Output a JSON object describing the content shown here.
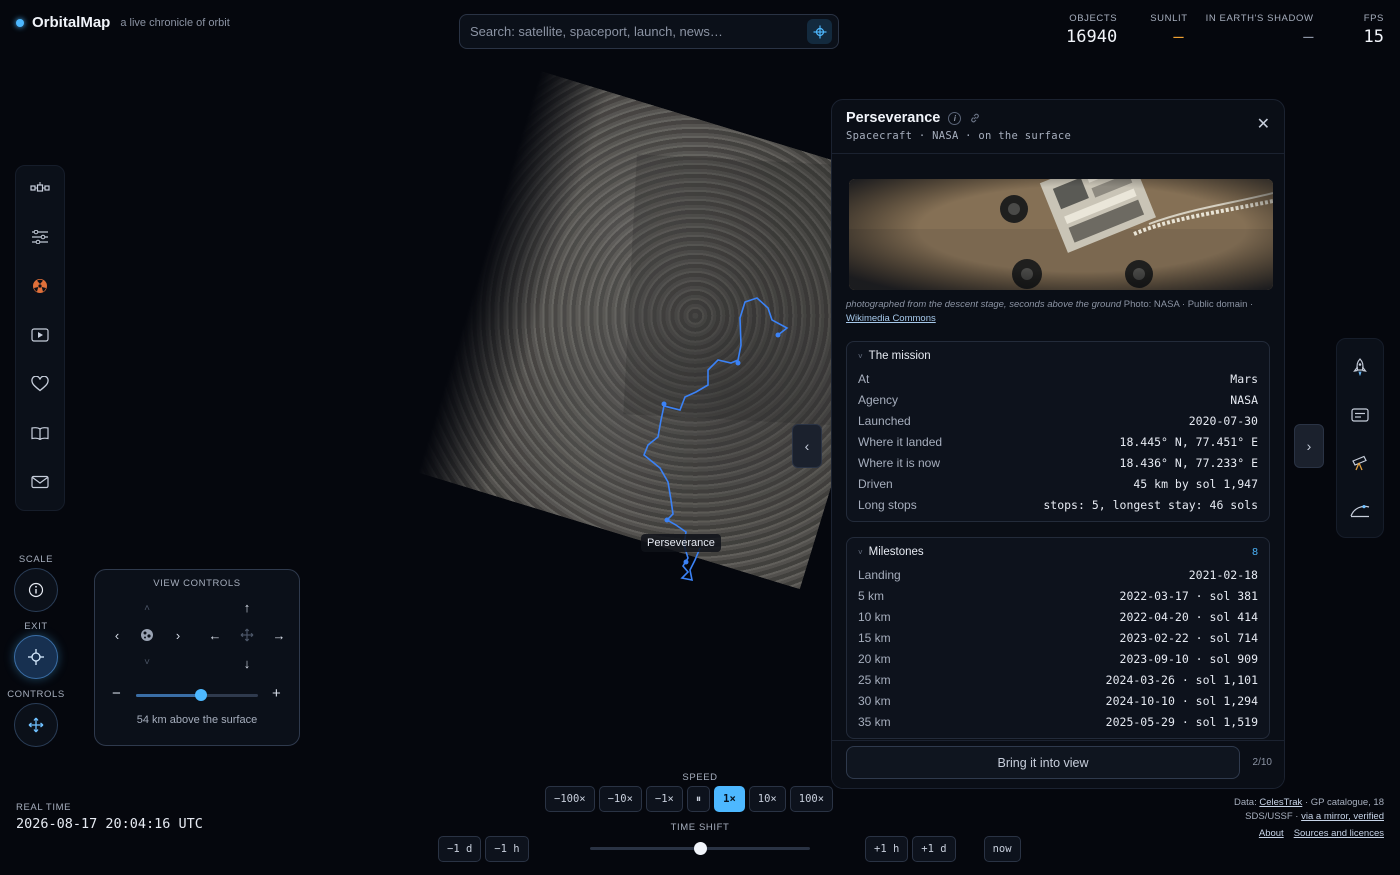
{
  "brand": {
    "name": "OrbitalMap",
    "tagline": "a live chronicle of orbit"
  },
  "search": {
    "placeholder": "Search: satellite, spaceport, launch, news…",
    "icon": "crosshair-icon"
  },
  "stats": [
    {
      "label": "OBJECTS",
      "value": "16940"
    },
    {
      "label": "SUNLIT",
      "value": "–"
    },
    {
      "label": "IN EARTH'S SHADOW",
      "value": "–"
    },
    {
      "label": "FPS",
      "value": "15"
    }
  ],
  "left_rail": [
    "satellite-icon",
    "sliders-icon",
    "radiation-icon",
    "play-icon",
    "heart-icon",
    "book-icon",
    "mail-icon"
  ],
  "side_controls": {
    "scale_label": "SCALE",
    "exit_label": "EXIT",
    "controls_label": "CONTROLS"
  },
  "view_controls": {
    "title": "VIEW CONTROLS",
    "altitude_text": "54 km above the surface",
    "zoom_level": 0.53
  },
  "map": {
    "label": "Perseverance"
  },
  "panel": {
    "title": "Perseverance",
    "subtitle": "Spacecraft · NASA · on the surface",
    "caption_italic": "photographed from the descent stage, seconds above the ground",
    "caption_credit": " Photo: NASA · Public domain · ",
    "caption_link": "Wikimedia Commons",
    "mission": {
      "title": "The mission",
      "rows": [
        {
          "k": "At",
          "v": "Mars"
        },
        {
          "k": "Agency",
          "v": "NASA"
        },
        {
          "k": "Launched",
          "v": "2020-07-30"
        },
        {
          "k": "Where it landed",
          "v": "18.445° N, 77.451° E"
        },
        {
          "k": "Where it is now",
          "v": "18.436° N, 77.233° E"
        },
        {
          "k": "Driven",
          "v": "45 km by sol 1,947"
        },
        {
          "k": "Long stops",
          "v": "stops: 5, longest stay: 46 sols"
        }
      ]
    },
    "milestones": {
      "title": "Milestones",
      "count": "8",
      "rows": [
        {
          "k": "Landing",
          "v": "2021-02-18"
        },
        {
          "k": "5 km",
          "v": "2022-03-17 · sol 381"
        },
        {
          "k": "10 km",
          "v": "2022-04-20 · sol 414"
        },
        {
          "k": "15 km",
          "v": "2023-02-22 · sol 714"
        },
        {
          "k": "20 km",
          "v": "2023-09-10 · sol 909"
        },
        {
          "k": "25 km",
          "v": "2024-03-26 · sol 1,101"
        },
        {
          "k": "30 km",
          "v": "2024-10-10 · sol 1,294"
        },
        {
          "k": "35 km",
          "v": "2025-05-29 · sol 1,519"
        }
      ]
    },
    "bring_button": "Bring it into view",
    "pager": "2/10"
  },
  "right_rail": [
    "rocket-icon",
    "card-icon",
    "telescope-icon",
    "orbit-icon"
  ],
  "bottom": {
    "realtime_label": "REAL TIME",
    "realtime_value": "2026-08-17 20:04:16 UTC",
    "speed_label": "SPEED",
    "speeds": [
      "−100×",
      "−10×",
      "−1×",
      "⏸",
      "1×",
      "10×",
      "100×"
    ],
    "active_speed": "1×",
    "timeshift_label": "TIME SHIFT",
    "shift_back": [
      "−1 d",
      "−1 h"
    ],
    "shift_fwd": [
      "+1 h",
      "+1 d",
      "now"
    ],
    "timeshift_position": 0.5
  },
  "credits": {
    "prefix": "Data: ",
    "celestrak": "CelesTrak",
    "mid": " · GP catalogue, 18 SDS/USSF · ",
    "mirror": "via a mirror, verified",
    "about": "About",
    "sources": "Sources and licences"
  },
  "colors": {
    "accent": "#4db8ff",
    "sunlit": "#f0a030",
    "route": "#3b82f6"
  }
}
